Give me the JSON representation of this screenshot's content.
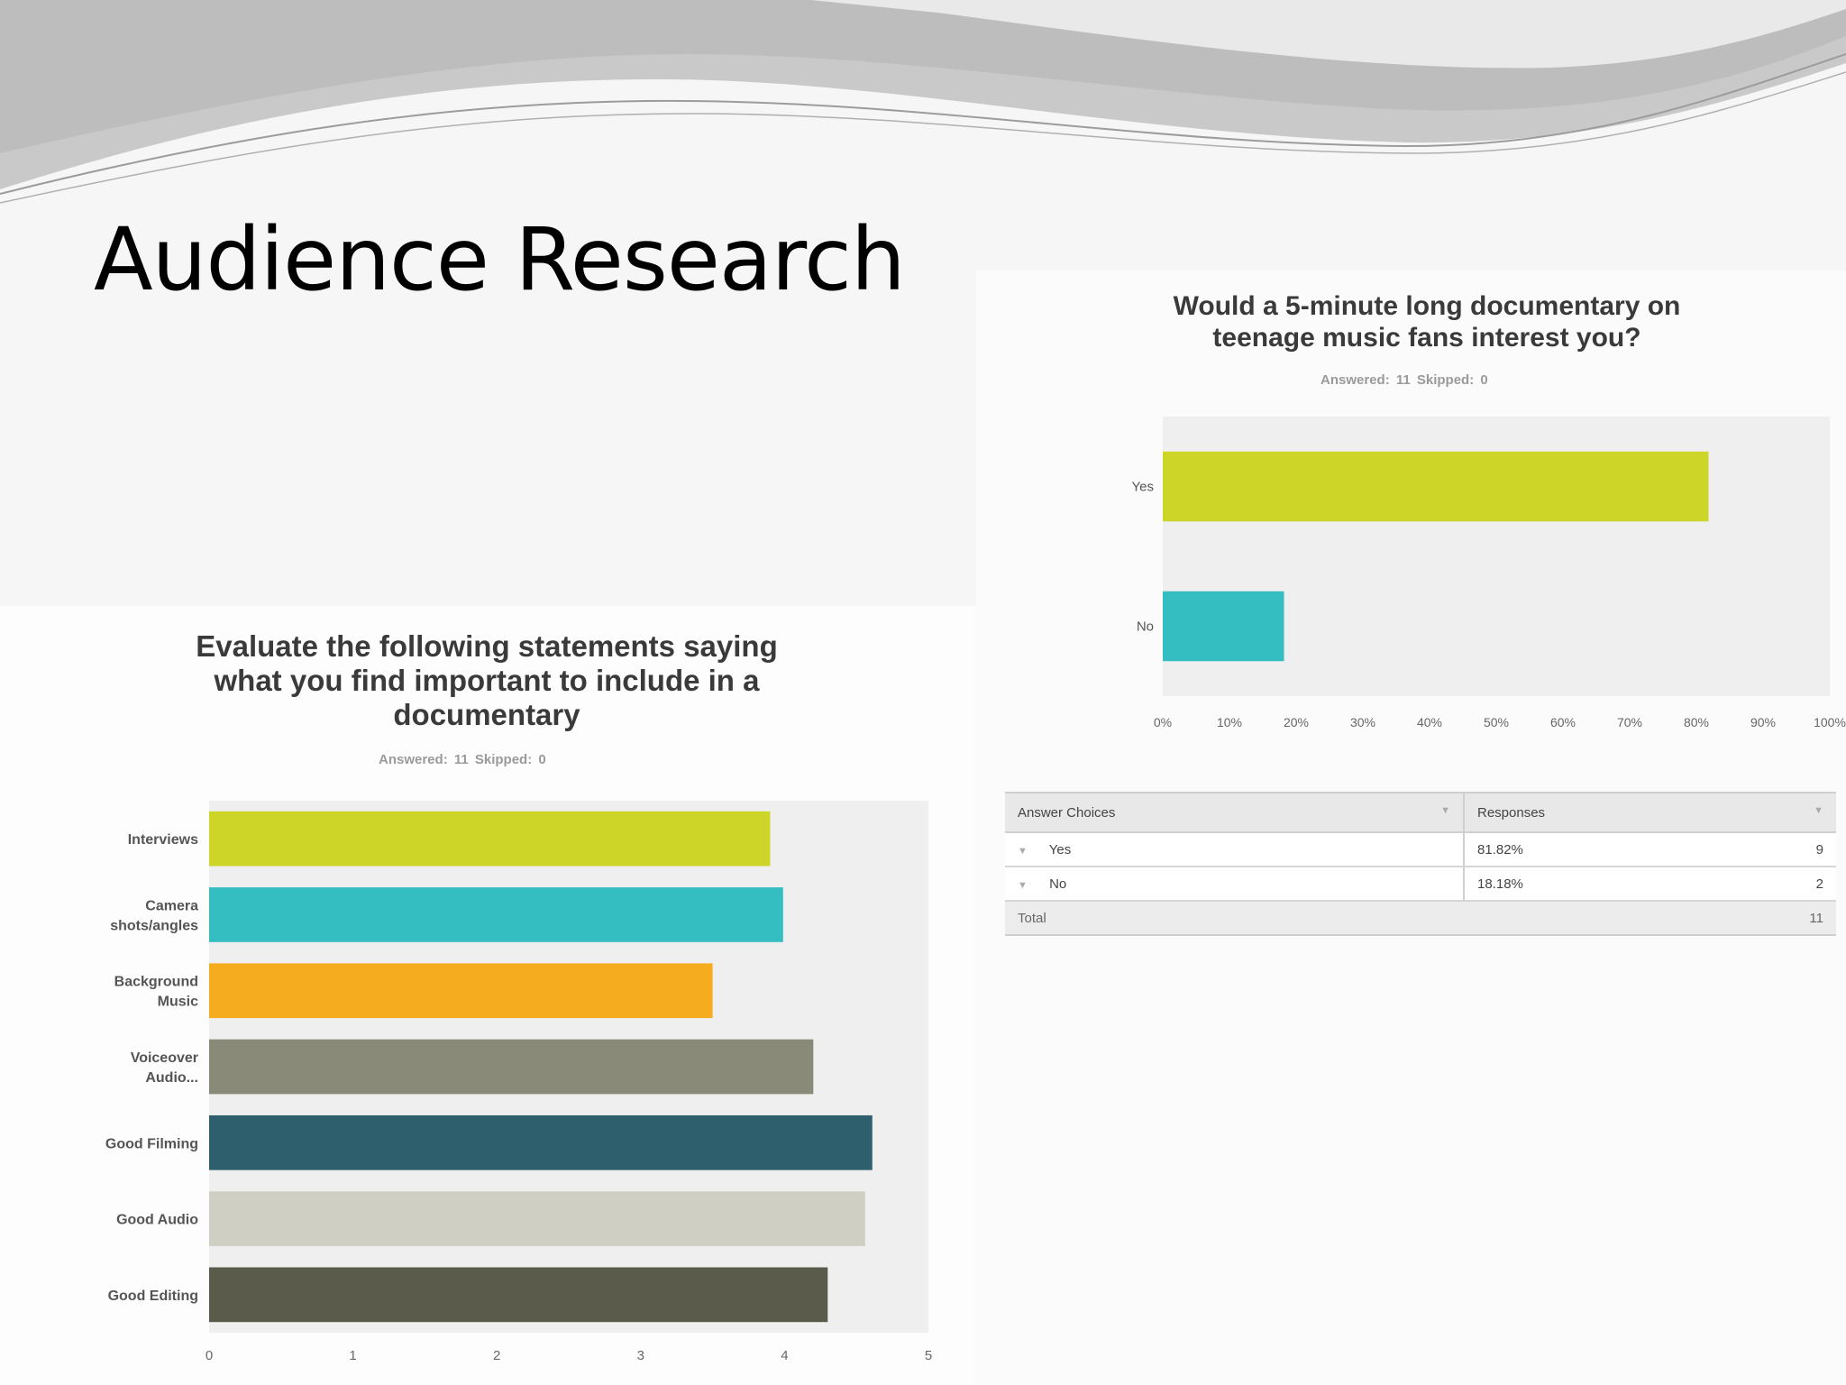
{
  "slide": {
    "title": "Audience Research"
  },
  "chart_data": [
    {
      "type": "bar",
      "orientation": "horizontal",
      "title": "Evaluate the following statements saying\nwhat you find important to include in a\ndocumentary",
      "subtitle": "Answered: 11   Skipped: 0",
      "categories": [
        "Interviews",
        "Camera shots/angles",
        "Background Music",
        "Voiceover Audio...",
        "Good Filming",
        "Good Audio",
        "Good Editing"
      ],
      "category_lines": [
        [
          "Interviews"
        ],
        [
          "Camera",
          "shots/angles"
        ],
        [
          "Background",
          "Music"
        ],
        [
          "Voiceover",
          "Audio..."
        ],
        [
          "Good Filming"
        ],
        [
          "Good Audio"
        ],
        [
          "Good Editing"
        ]
      ],
      "values": [
        3.9,
        3.99,
        3.5,
        4.2,
        4.61,
        4.56,
        4.3
      ],
      "colors": [
        "#cdd628",
        "#34bec1",
        "#f5ad1f",
        "#8a8a79",
        "#2e5f6c",
        "#cfcfc3",
        "#5b5b4c"
      ],
      "xlim": [
        0,
        5
      ],
      "xticks": [
        "0",
        "1",
        "2",
        "3",
        "4",
        "5"
      ],
      "grid": false,
      "legend": "none"
    },
    {
      "type": "bar",
      "orientation": "horizontal",
      "title": "Would a 5-minute long documentary on\nteenage music fans interest you?",
      "subtitle": "Answered: 11   Skipped: 0",
      "categories": [
        "Yes",
        "No"
      ],
      "values": [
        81.82,
        18.18
      ],
      "colors": [
        "#cdd628",
        "#34bec1"
      ],
      "xlim": [
        0,
        100
      ],
      "xticks": [
        "0%",
        "10%",
        "20%",
        "30%",
        "40%",
        "50%",
        "60%",
        "70%",
        "80%",
        "90%",
        "100%"
      ],
      "grid": false,
      "legend": "none"
    },
    {
      "type": "table",
      "headers": [
        "Answer Choices",
        "Responses"
      ],
      "rows": [
        {
          "choice": "Yes",
          "percent": "81.82%",
          "count": "9"
        },
        {
          "choice": "No",
          "percent": "18.18%",
          "count": "2"
        }
      ],
      "total_label": "Total",
      "total_count": "11"
    }
  ]
}
